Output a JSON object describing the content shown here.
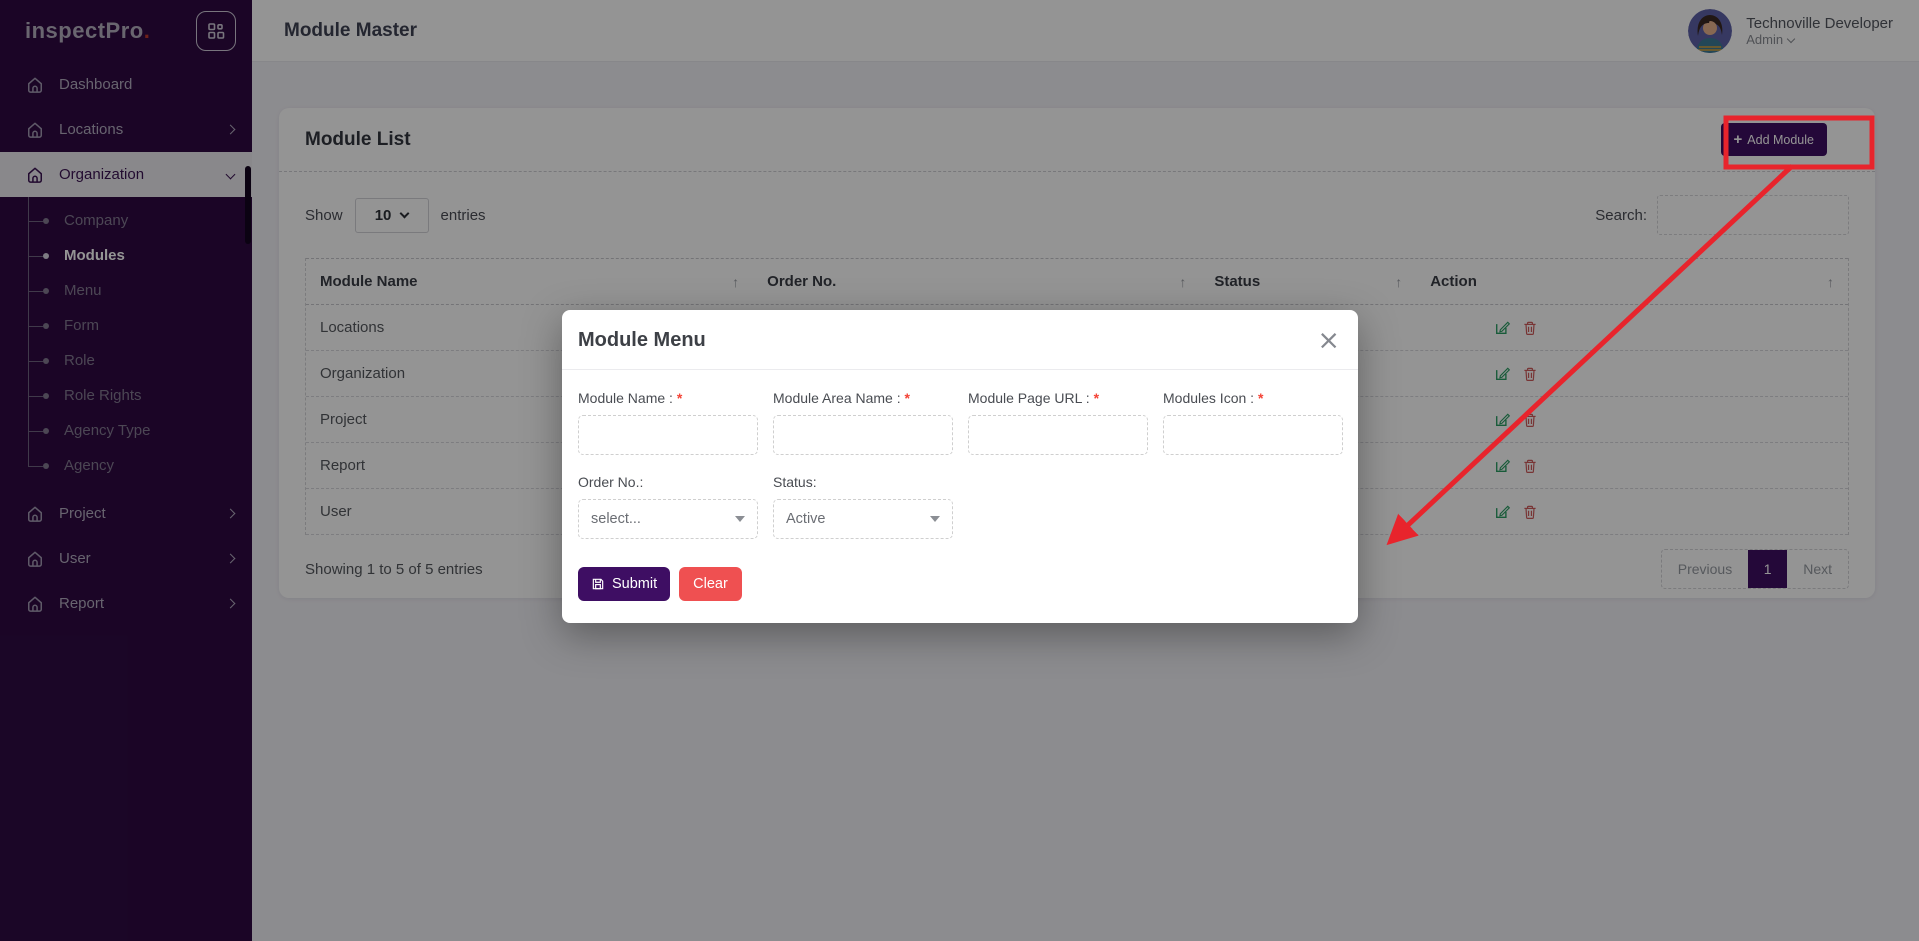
{
  "brand": {
    "name": "inspectPro",
    "dot": ".",
    "accent_red": "#c0392b"
  },
  "header": {
    "title": "Module Master",
    "user": {
      "name": "Technoville Developer",
      "role": "Admin"
    }
  },
  "sidebar": {
    "items": [
      {
        "label": "Dashboard"
      },
      {
        "label": "Locations"
      },
      {
        "label": "Organization"
      },
      {
        "label": "Project"
      },
      {
        "label": "User"
      },
      {
        "label": "Report"
      }
    ],
    "organization_children": [
      {
        "label": "Company"
      },
      {
        "label": "Modules"
      },
      {
        "label": "Menu"
      },
      {
        "label": "Form"
      },
      {
        "label": "Role"
      },
      {
        "label": "Role Rights"
      },
      {
        "label": "Agency Type"
      },
      {
        "label": "Agency"
      }
    ]
  },
  "module_list": {
    "title": "Module List",
    "add_button_plus": "+",
    "add_button_label": "Add Module",
    "show_label": "Show",
    "page_size": "10",
    "entries_label": "entries",
    "search_label": "Search:",
    "sort_icon": "↑",
    "columns": [
      "Module Name",
      "Order No.",
      "Status",
      "Action"
    ],
    "rows": [
      {
        "name": "Locations"
      },
      {
        "name": "Organization"
      },
      {
        "name": "Project"
      },
      {
        "name": "Report"
      },
      {
        "name": "User"
      }
    ],
    "summary": "Showing 1 to 5 of 5 entries",
    "pagination": {
      "previous": "Previous",
      "page": "1",
      "next": "Next"
    }
  },
  "modal": {
    "title": "Module Menu",
    "close": "×",
    "required_mark": "*",
    "fields": [
      {
        "label": "Module Name : "
      },
      {
        "label": "Module Area Name : "
      },
      {
        "label": "Module Page URL : "
      },
      {
        "label": "Modules Icon : "
      }
    ],
    "order_no_label": "Order No.:",
    "order_no_value": "select...",
    "status_label": "Status:",
    "status_value": "Active",
    "submit_label": "Submit",
    "clear_label": "Clear"
  },
  "colors": {
    "sidebar_bg": "#2f0a43",
    "accent_purple": "#3e0e63",
    "danger_red": "#ef5051",
    "annotation_red": "#e8242c",
    "edit_green": "#2a9d63",
    "delete_red": "#cf5c5c"
  }
}
